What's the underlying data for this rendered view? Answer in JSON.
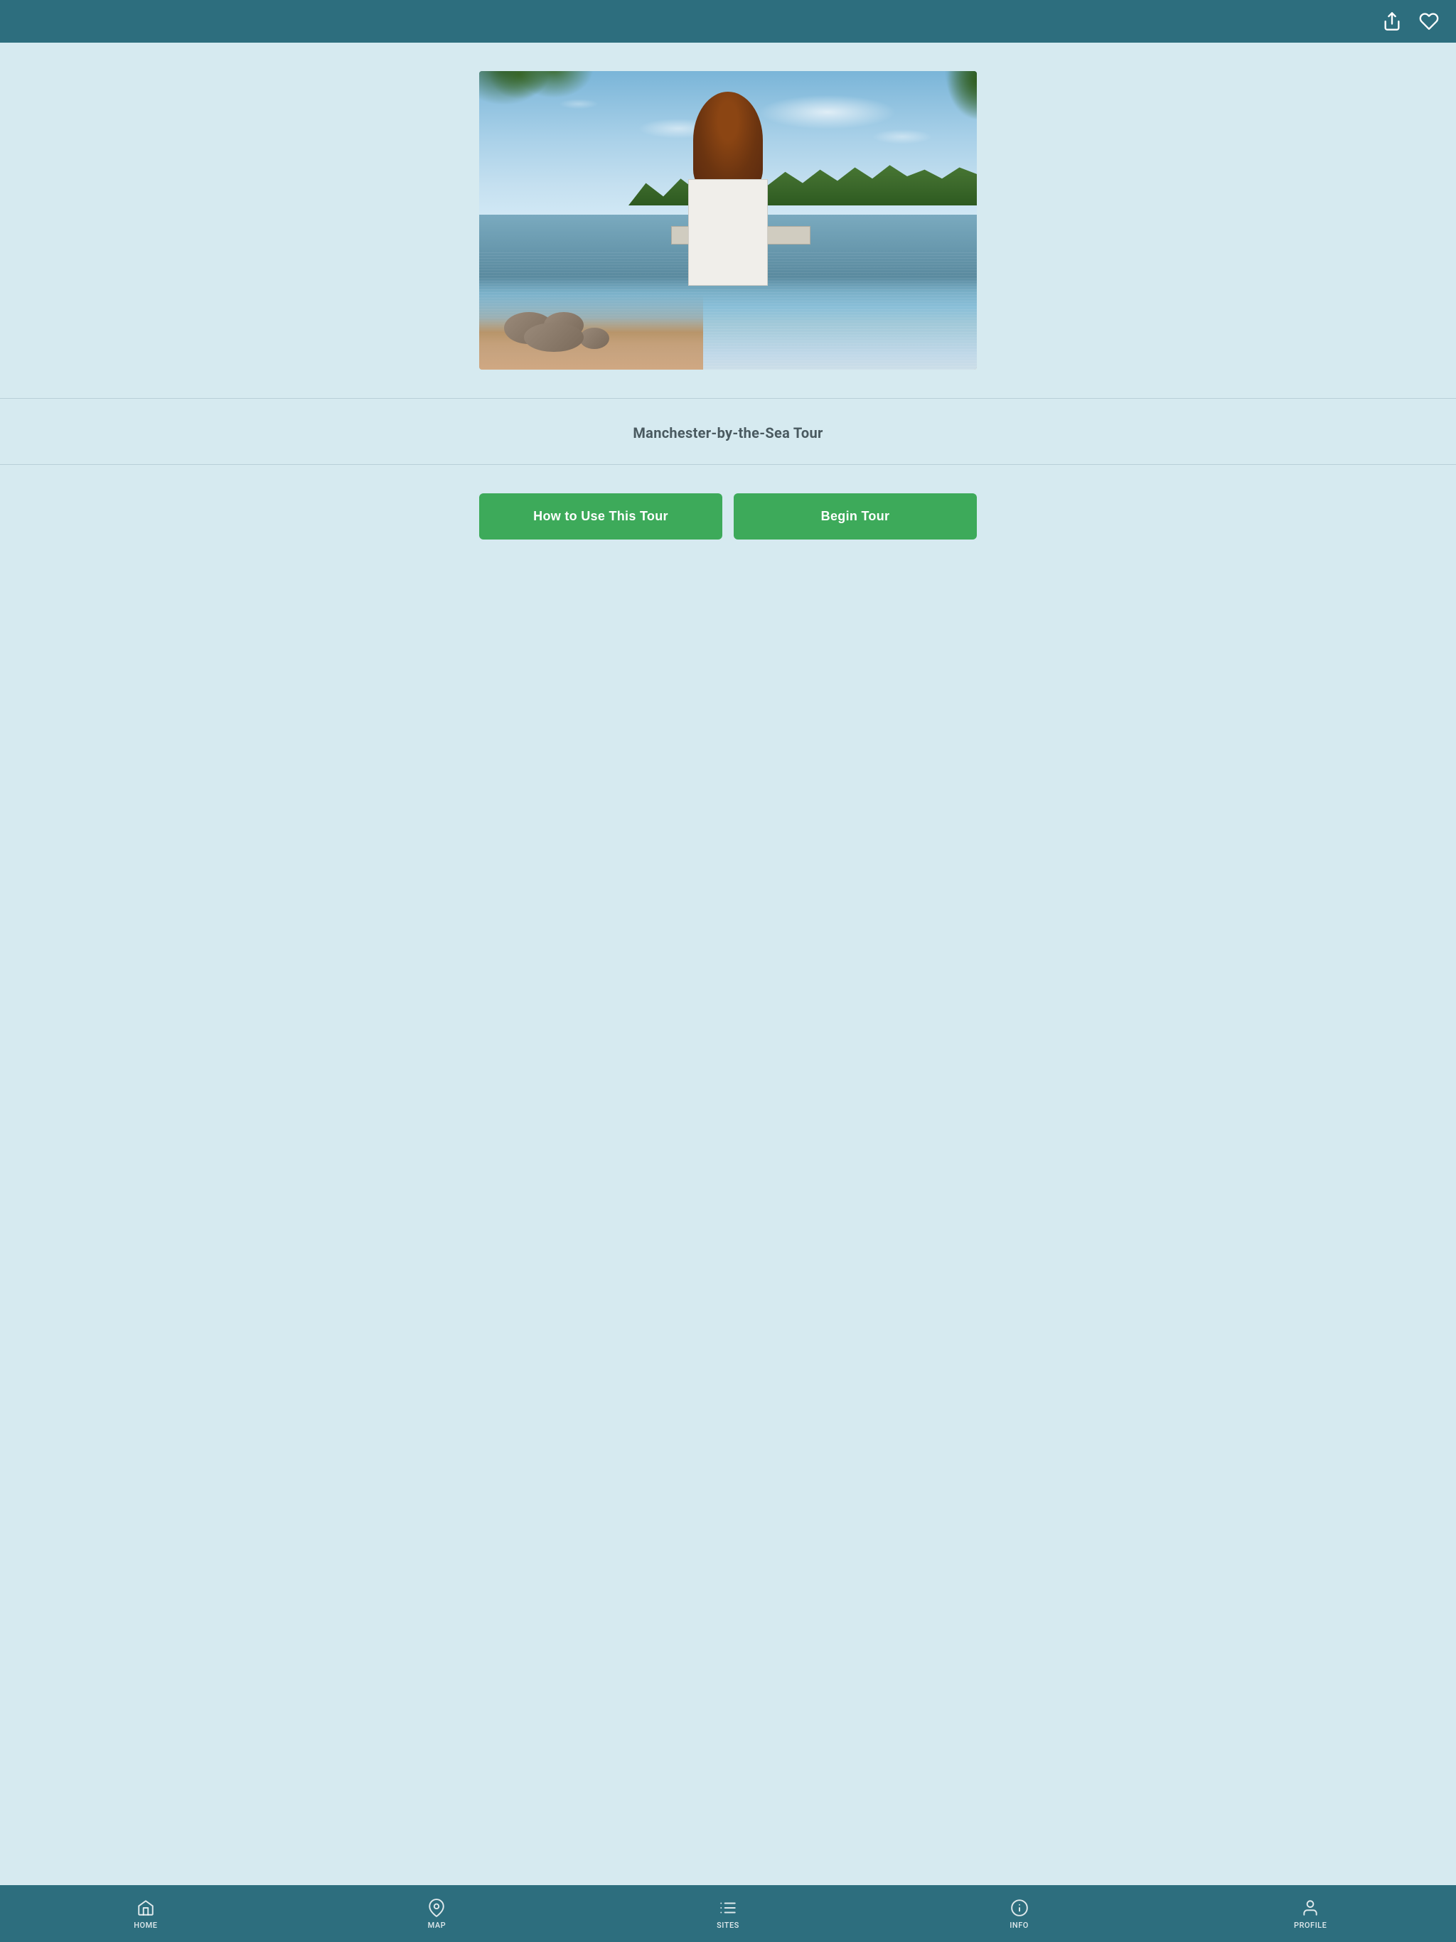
{
  "header": {
    "share_icon": "share-icon",
    "favorite_icon": "heart-icon",
    "background_color": "#2d6e7e"
  },
  "hero": {
    "alt": "Manchester-by-the-Sea harbor with pavilion and dock"
  },
  "tour": {
    "title": "Manchester-by-the-Sea Tour"
  },
  "buttons": {
    "how_to_use": "How to Use This Tour",
    "begin_tour": "Begin Tour"
  },
  "bottom_nav": {
    "items": [
      {
        "id": "home",
        "label": "HOME",
        "icon": "home-icon"
      },
      {
        "id": "map",
        "label": "MAP",
        "icon": "map-pin-icon"
      },
      {
        "id": "sites",
        "label": "SITES",
        "icon": "list-icon"
      },
      {
        "id": "info",
        "label": "INFO",
        "icon": "info-icon"
      },
      {
        "id": "profile",
        "label": "Profile",
        "icon": "person-icon"
      }
    ]
  }
}
